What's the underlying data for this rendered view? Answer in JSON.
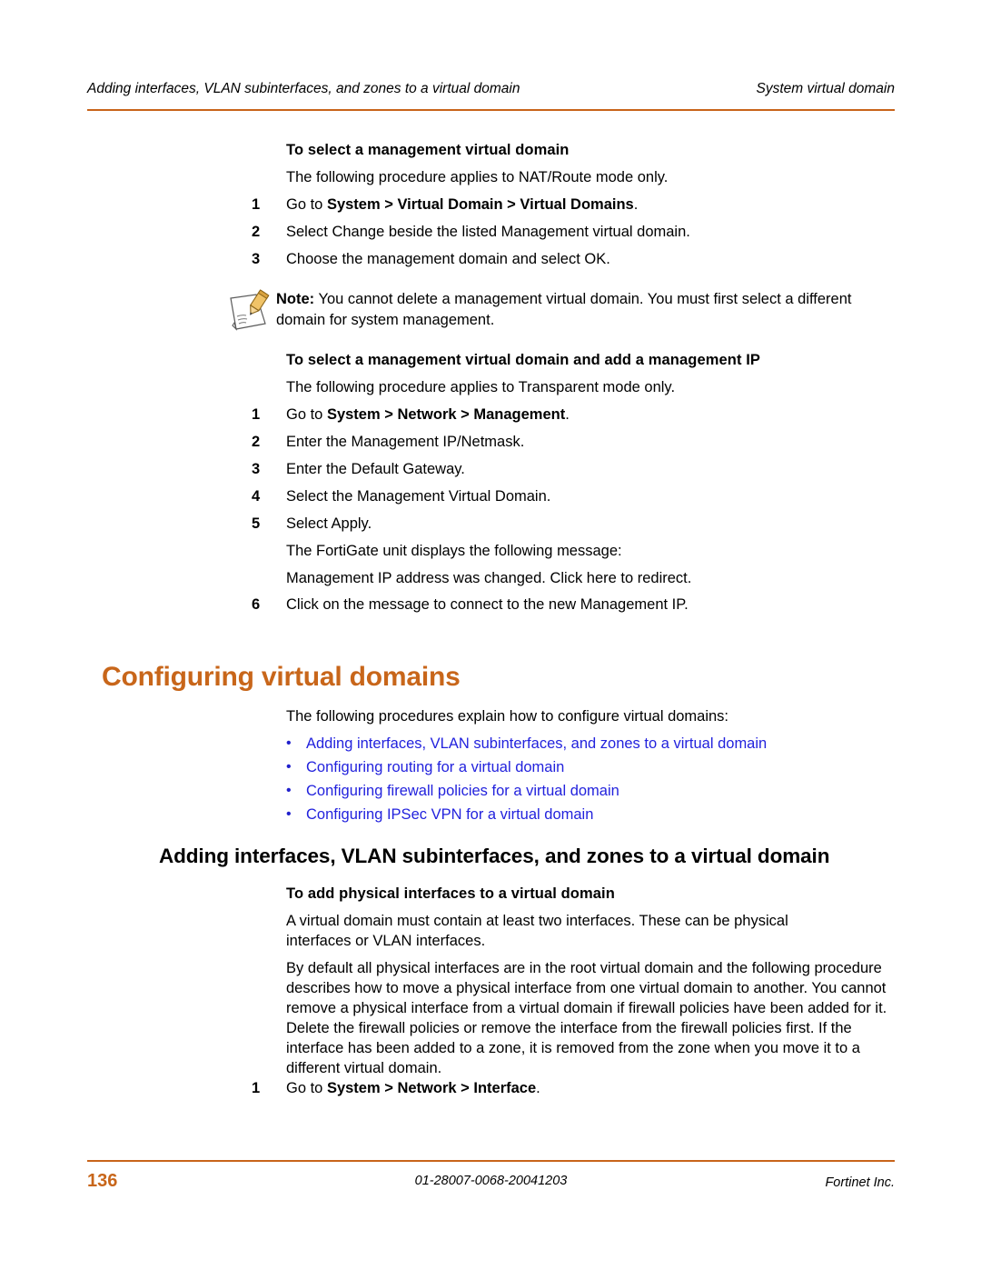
{
  "header": {
    "left": "Adding interfaces, VLAN subinterfaces, and zones to a virtual domain",
    "right": "System virtual domain"
  },
  "procedure1": {
    "title": "To select a management virtual domain",
    "intro": "The following procedure applies to NAT/Route mode only.",
    "steps": [
      {
        "num": "1",
        "pre": "Go to ",
        "bold": "System > Virtual Domain > Virtual Domains",
        "post": "."
      },
      {
        "num": "2",
        "pre": "Select Change beside the listed Management virtual domain.",
        "bold": "",
        "post": ""
      },
      {
        "num": "3",
        "pre": "Choose the management domain and select OK.",
        "bold": "",
        "post": ""
      }
    ]
  },
  "note": {
    "icon": "note-pencil-icon",
    "label": "Note:",
    "text": " You cannot delete a management virtual domain. You must first select a different domain for system management."
  },
  "procedure2": {
    "title": "To select a management virtual domain and add a management IP",
    "intro": "The following procedure applies to Transparent mode only.",
    "steps": [
      {
        "num": "1",
        "pre": "Go to ",
        "bold": "System > Network > Management",
        "post": "."
      },
      {
        "num": "2",
        "pre": "Enter the Management IP/Netmask.",
        "bold": "",
        "post": ""
      },
      {
        "num": "3",
        "pre": "Enter the Default Gateway.",
        "bold": "",
        "post": ""
      },
      {
        "num": "4",
        "pre": "Select the Management Virtual Domain.",
        "bold": "",
        "post": ""
      },
      {
        "num": "5",
        "pre": "Select Apply.",
        "bold": "",
        "post": ""
      }
    ],
    "after_step5_line1": "The FortiGate unit displays the following message:",
    "after_step5_line2": "Management IP address was changed. Click here to redirect.",
    "step6": {
      "num": "6",
      "pre": "Click on the message to connect to the new Management IP.",
      "bold": "",
      "post": ""
    }
  },
  "chapter": {
    "heading": "Configuring virtual domains",
    "heading_color": "#C8661A",
    "intro": "The following procedures explain how to configure virtual domains:",
    "links": [
      "Adding interfaces, VLAN subinterfaces, and zones to a virtual domain",
      "Configuring routing for a virtual domain",
      "Configuring firewall policies for a virtual domain",
      "Configuring IPSec VPN for a virtual domain"
    ],
    "link_color": "#2222DD",
    "bullet_glyph": "•"
  },
  "section": {
    "heading": "Adding interfaces, VLAN subinterfaces, and zones to a virtual domain",
    "sub_title": "To add physical interfaces to a virtual domain",
    "para1": "A virtual domain must contain at least two interfaces. These can be physical interfaces or VLAN interfaces.",
    "para2": "By default all physical interfaces are in the root virtual domain and the following procedure describes how to move a physical interface from one virtual domain to another. You cannot remove a physical interface from a virtual domain if firewall policies have been added for it. Delete the firewall policies or remove the interface from the firewall policies first. If the interface has been added to a zone, it is removed from the zone when you move it to a different virtual domain.",
    "step1": {
      "num": "1",
      "pre": "Go to ",
      "bold": "System > Network > Interface",
      "post": "."
    }
  },
  "footer": {
    "page_number": "136",
    "doc_id": "01-28007-0068-20041203",
    "company": "Fortinet Inc.",
    "rule_color": "#C8641A"
  }
}
